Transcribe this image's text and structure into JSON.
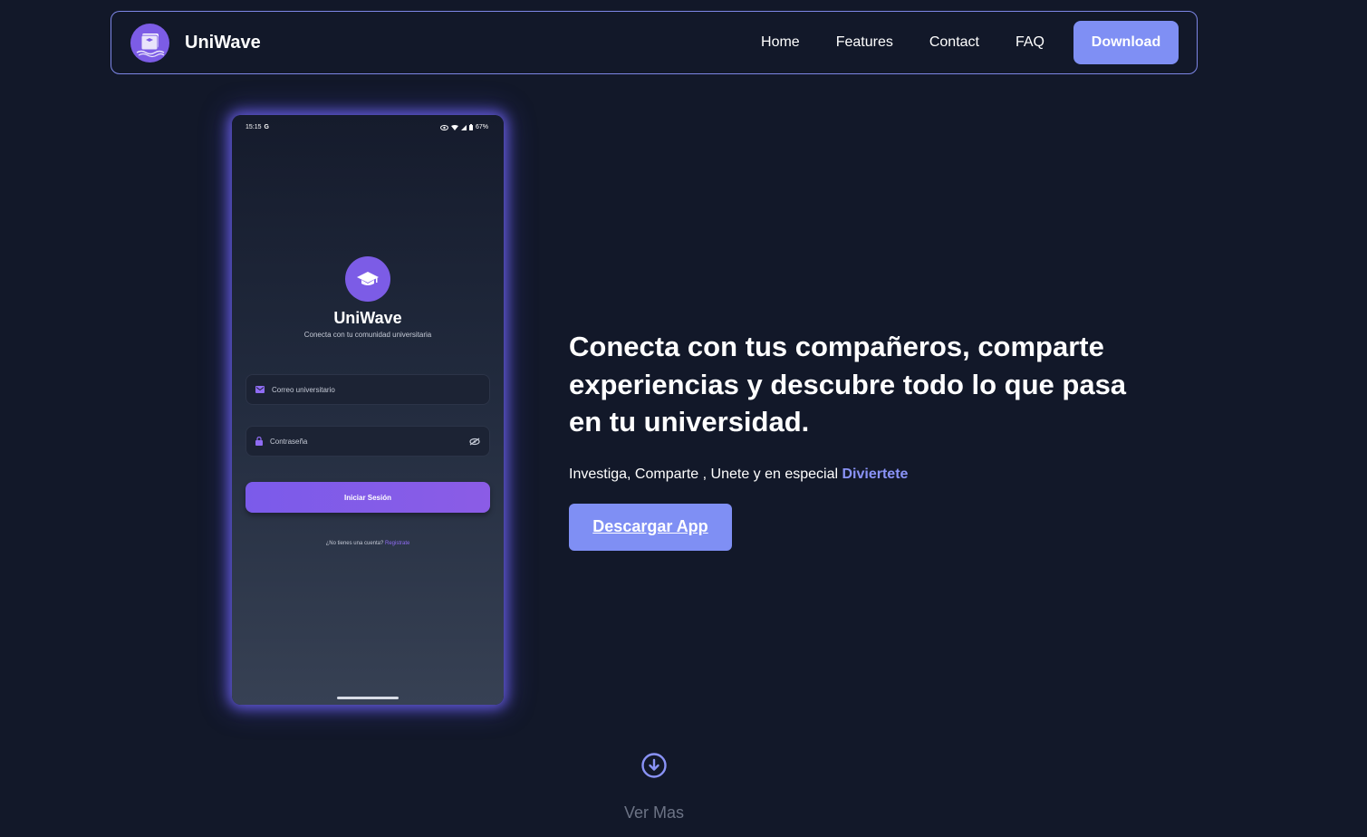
{
  "colors": {
    "background": "#121829",
    "accent": "#7f8ff4",
    "accent_text": "#8a93f7",
    "brand_purple": "#7c5ce6",
    "nav_border": "#7d86e6",
    "muted": "#6c7385"
  },
  "navbar": {
    "brand": {
      "logo_icon": "book-wave-logo-icon",
      "name": "UniWave"
    },
    "links": [
      "Home",
      "Features",
      "Contact",
      "FAQ"
    ],
    "download_label": "Download"
  },
  "phone": {
    "status": {
      "time": "15:15",
      "battery": "67%"
    },
    "logo_icon": "graduation-cap-icon",
    "title": "UniWave",
    "subtitle": "Conecta con tu comunidad universitaria",
    "email_placeholder": "Correo universitario",
    "password_placeholder": "Contraseña",
    "login_label": "Iniciar Sesión",
    "register_prompt": "¿No tienes una cuenta?",
    "register_link": "Registrate"
  },
  "hero": {
    "title": "Conecta con tus compañeros, comparte experiencias y descubre todo lo que pasa en tu universidad.",
    "subtitle": "Investiga, Comparte , Unete y en especial",
    "subtitle_accent": "Diviertete",
    "cta_label": "Descargar App"
  },
  "more": {
    "icon": "arrow-down-circle-icon",
    "label": "Ver Mas"
  }
}
